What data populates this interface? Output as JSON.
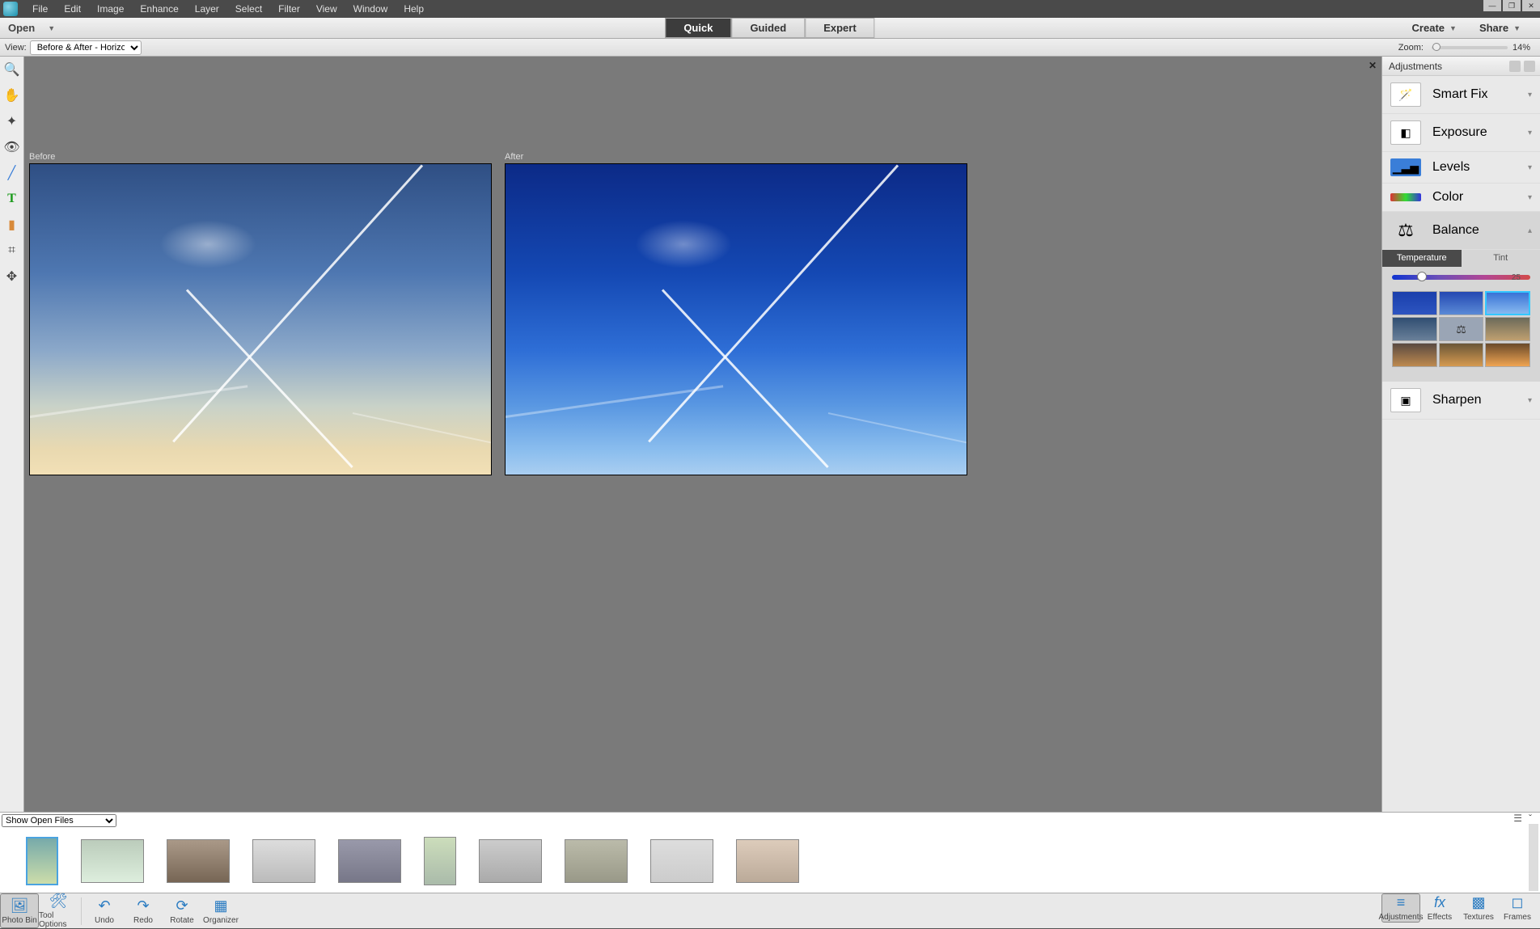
{
  "menu": [
    "File",
    "Edit",
    "Image",
    "Enhance",
    "Layer",
    "Select",
    "Filter",
    "View",
    "Window",
    "Help"
  ],
  "appbar": {
    "open": "Open",
    "create": "Create",
    "share": "Share"
  },
  "modes": {
    "quick": "Quick",
    "guided": "Guided",
    "expert": "Expert"
  },
  "viewbar": {
    "label": "View:",
    "value": "Before & After - Horizontal",
    "zoom_label": "Zoom:",
    "zoom_pct": "14%"
  },
  "canvas": {
    "before": "Before",
    "after": "After"
  },
  "adjustments": {
    "title": "Adjustments",
    "smartfix": "Smart Fix",
    "exposure": "Exposure",
    "levels": "Levels",
    "color": "Color",
    "balance": "Balance",
    "temperature_tab": "Temperature",
    "tint_tab": "Tint",
    "temperature_value": "25",
    "sharpen": "Sharpen"
  },
  "photobin": {
    "show": "Show Open Files",
    "thumb_count": 10
  },
  "footer": {
    "photobin": "Photo Bin",
    "toolopts": "Tool Options",
    "undo": "Undo",
    "redo": "Redo",
    "rotate": "Rotate",
    "organizer": "Organizer",
    "adjustments": "Adjustments",
    "effects": "Effects",
    "textures": "Textures",
    "frames": "Frames"
  }
}
